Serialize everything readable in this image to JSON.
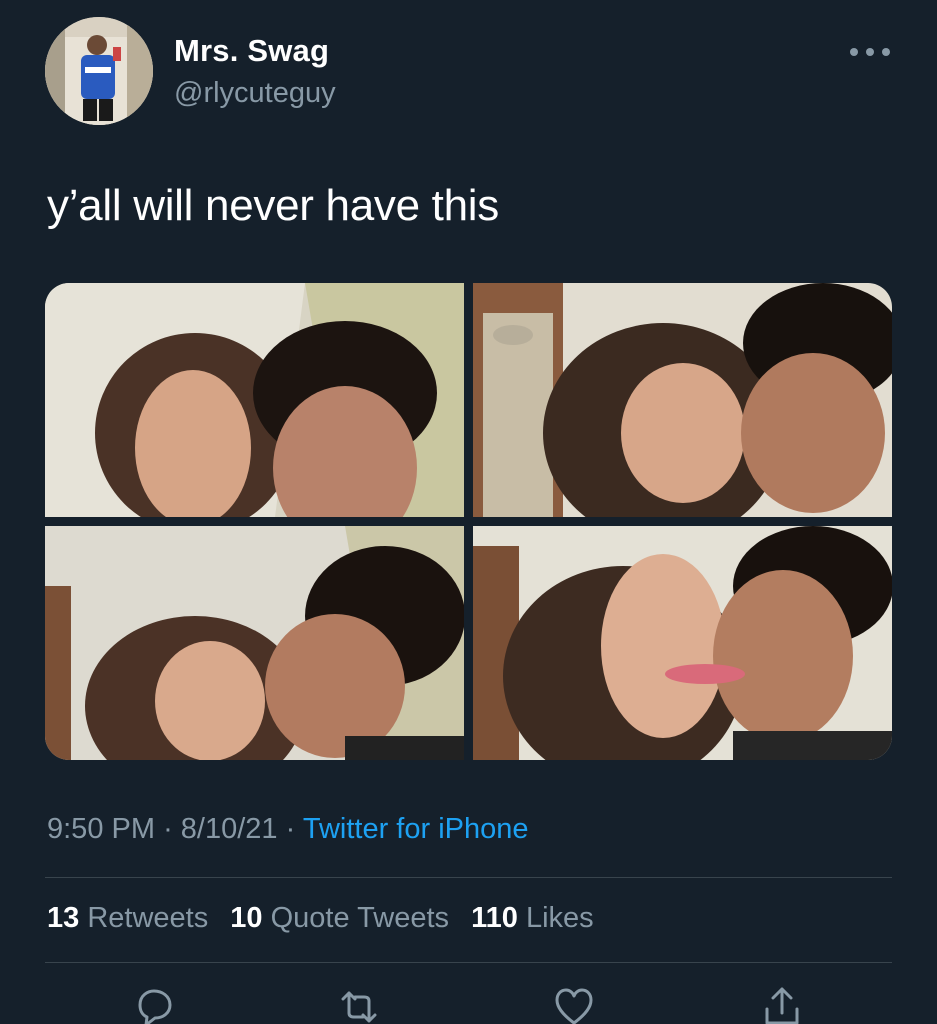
{
  "user": {
    "display_name": "Mrs. Swag",
    "handle": "@rlycuteguy"
  },
  "tweet": {
    "text": "y’all will never have this"
  },
  "meta": {
    "time": "9:50 PM",
    "separator": "·",
    "date": "8/10/21",
    "source": "Twitter for iPhone"
  },
  "stats": {
    "retweets_count": "13",
    "retweets_label": "Retweets",
    "quotes_count": "10",
    "quotes_label": "Quote Tweets",
    "likes_count": "110",
    "likes_label": "Likes"
  },
  "icons": [
    "more-icon",
    "reply-icon",
    "retweet-icon",
    "like-icon",
    "share-icon"
  ],
  "colors": {
    "background": "#15202b",
    "text": "#ffffff",
    "secondary": "#8899a6",
    "link": "#1da1f2",
    "divider": "#38444d"
  }
}
